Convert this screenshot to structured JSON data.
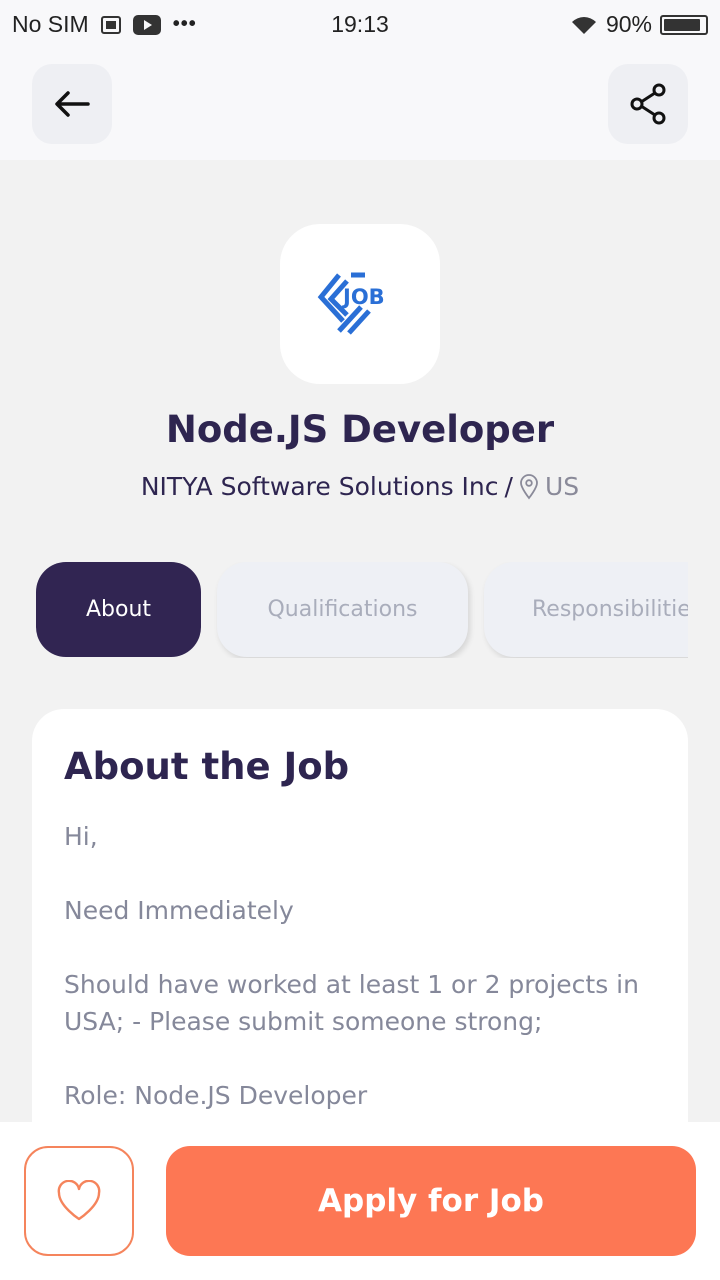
{
  "status_bar": {
    "carrier": "No SIM",
    "time": "19:13",
    "battery": "90%",
    "battery_level": 0.9,
    "icons": [
      "inbox-icon",
      "youtube-icon",
      "more-dots-icon",
      "wifi-icon",
      "battery-icon"
    ]
  },
  "header": {
    "back_icon": "arrow-left-icon",
    "share_icon": "share-icon"
  },
  "job": {
    "logo_text": "JOB",
    "title": "Node.JS Developer",
    "company": "NITYA Software Solutions Inc",
    "separator": "/",
    "location": "US"
  },
  "tabs": [
    {
      "label": "About",
      "active": true
    },
    {
      "label": "Qualifications",
      "active": false
    },
    {
      "label": "Responsibilities",
      "active": false
    }
  ],
  "about": {
    "title": "About the Job",
    "paragraphs": [
      "Hi,",
      "Need Immediately",
      "Should have worked at least 1 or 2 projects in USA; - Please submit someone strong;",
      "Role: Node.JS Developer"
    ]
  },
  "actions": {
    "favorite_icon": "heart-icon",
    "apply_label": "Apply for Job"
  },
  "colors": {
    "primary": "#312552",
    "accent": "#fd7754",
    "muted_text": "#85889a"
  }
}
